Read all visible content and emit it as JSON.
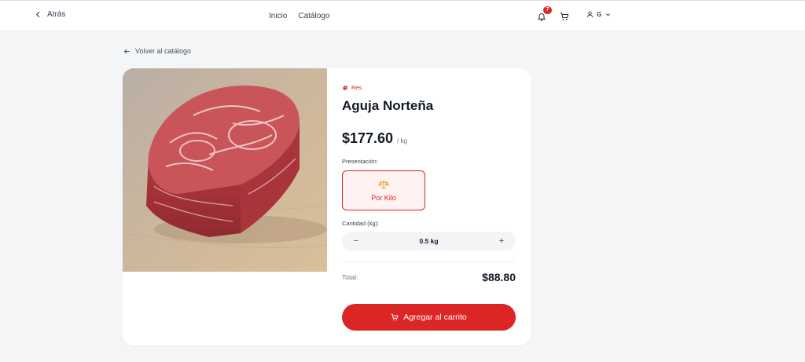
{
  "header": {
    "back_label": "Atrás",
    "nav": [
      "Inicio",
      "Catálogo"
    ],
    "notifications_count": "7",
    "user_initial": "G"
  },
  "back_link": "Volver al catálogo",
  "product": {
    "category": "Res",
    "name": "Aguja Norteña",
    "price": "$177.60",
    "price_unit": "/ kg",
    "presentation_label": "Presentación:",
    "presentation_option": "Por Kilo",
    "quantity_label": "Cantidad (kg):",
    "quantity_value": "0.5 kg",
    "decrement": "−",
    "increment": "+",
    "total_label": "Total:",
    "total_value": "$88.80",
    "add_to_cart": "Agregar al carrito"
  },
  "colors": {
    "accent": "#dc2626",
    "background": "#f4f5f7",
    "card": "#ffffff"
  }
}
